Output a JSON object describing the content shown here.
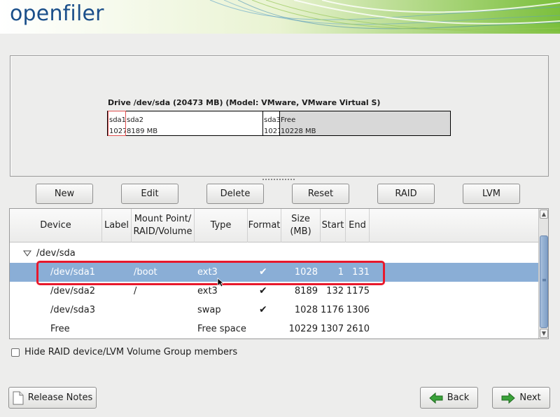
{
  "header": {
    "logo_text": "openfiler"
  },
  "drive": {
    "title": "Drive /dev/sda (20473 MB) (Model: VMware, VMware Virtual S)",
    "segments": [
      {
        "name": "sda1",
        "size": "1027"
      },
      {
        "name": "sda2",
        "size": "8189 MB"
      },
      {
        "name": "sda3",
        "size": "1027"
      },
      {
        "name": "Free",
        "size": "10228 MB"
      }
    ]
  },
  "toolbar": {
    "new_label": "New",
    "edit_label": "Edit",
    "delete_label": "Delete",
    "reset_label": "Reset",
    "raid_label": "RAID",
    "lvm_label": "LVM"
  },
  "table": {
    "columns": {
      "device": "Device",
      "label": "Label",
      "mount_1": "Mount Point/",
      "mount_2": "RAID/Volume",
      "type": "Type",
      "format": "Format",
      "size_1": "Size",
      "size_2": "(MB)",
      "start": "Start",
      "end": "End"
    },
    "group": "/dev/sda",
    "rows": [
      {
        "device": "/dev/sda1",
        "mount": "/boot",
        "type": "ext3",
        "format": "✔",
        "size": "1028",
        "start": "1",
        "end": "131"
      },
      {
        "device": "/dev/sda2",
        "mount": "/",
        "type": "ext3",
        "format": "✔",
        "size": "8189",
        "start": "132",
        "end": "1175"
      },
      {
        "device": "/dev/sda3",
        "mount": "",
        "type": "swap",
        "format": "✔",
        "size": "1028",
        "start": "1176",
        "end": "1306"
      },
      {
        "device": "Free",
        "mount": "",
        "type": "Free space",
        "format": "",
        "size": "10229",
        "start": "1307",
        "end": "2610"
      }
    ],
    "selected_row": 0
  },
  "options": {
    "hide_raid_label": "Hide RAID device/LVM Volume Group members"
  },
  "footer": {
    "release_notes_label": "Release Notes",
    "back_label": "Back",
    "next_label": "Next"
  },
  "colors": {
    "selection": "#8aaed6",
    "highlight": "#e8192c",
    "logo": "#1b4f8a",
    "arrow_green": "#3aa23a"
  },
  "icons": [
    "document-icon",
    "arrow-left-icon",
    "arrow-right-icon",
    "expander-down-icon",
    "checkmark-icon",
    "mouse-cursor-icon"
  ]
}
